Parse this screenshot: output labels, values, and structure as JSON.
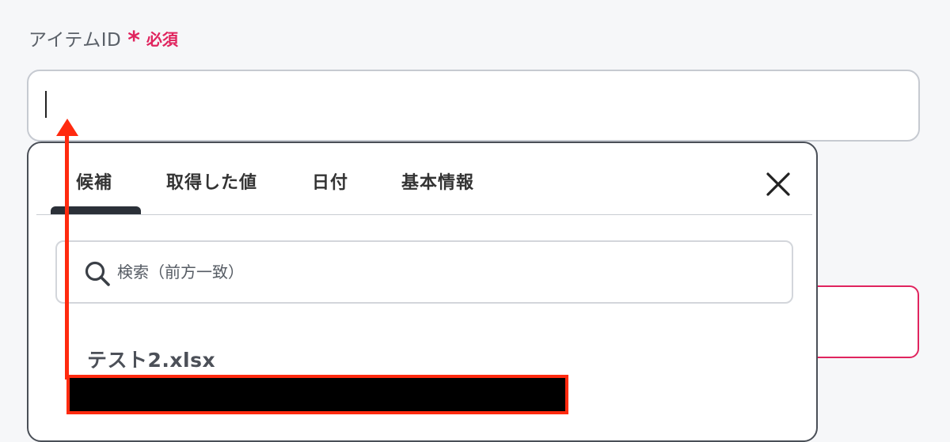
{
  "field": {
    "label": "アイテムID",
    "required_star": "*",
    "required_text": "必須",
    "value": ""
  },
  "popup": {
    "tabs": [
      {
        "label": "候補",
        "active": true
      },
      {
        "label": "取得した値",
        "active": false
      },
      {
        "label": "日付",
        "active": false
      },
      {
        "label": "基本情報",
        "active": false
      }
    ],
    "search_placeholder": "検索（前方一致）",
    "items": [
      {
        "label": "テスト2.xlsx"
      }
    ]
  },
  "icons": {
    "close": "close-icon",
    "search": "search-icon"
  },
  "colors": {
    "required": "#e0245e",
    "annotation": "#ff2a0f",
    "tab_indicator": "#2b3038"
  }
}
